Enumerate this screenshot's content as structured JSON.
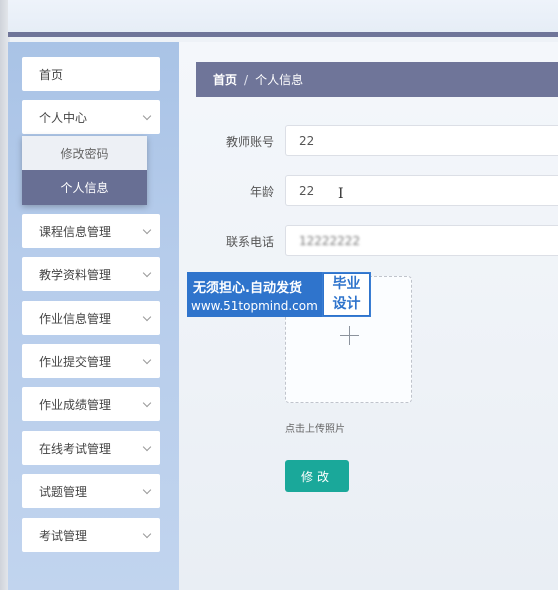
{
  "sidebar": {
    "items": [
      {
        "label": "首页",
        "has_children": false
      },
      {
        "label": "个人中心",
        "has_children": true
      },
      {
        "label": "课程信息管理",
        "has_children": true
      },
      {
        "label": "教学资料管理",
        "has_children": true
      },
      {
        "label": "作业信息管理",
        "has_children": true
      },
      {
        "label": "作业提交管理",
        "has_children": true
      },
      {
        "label": "作业成绩管理",
        "has_children": true
      },
      {
        "label": "在线考试管理",
        "has_children": true
      },
      {
        "label": "试题管理",
        "has_children": true
      },
      {
        "label": "考试管理",
        "has_children": true
      }
    ],
    "submenu": {
      "change_password": "修改密码",
      "profile": "个人信息"
    }
  },
  "breadcrumb": {
    "home": "首页",
    "separator": "/",
    "current": "个人信息"
  },
  "form": {
    "account_label": "教师账号",
    "account_value": "22",
    "age_label": "年龄",
    "age_value": "22",
    "phone_label": "联系电话",
    "phone_value": "12222222",
    "upload_hint": "点击上传照片",
    "submit_label": "修改"
  },
  "watermark": {
    "line1": "无须担心.自动发货",
    "line2": "www.51topmind.com",
    "badge_line1": "毕业",
    "badge_line2": "设计"
  },
  "colors": {
    "sidebar_bg": "#b0c8e8",
    "accent": "#6f7599",
    "submit": "#1aa89a"
  }
}
